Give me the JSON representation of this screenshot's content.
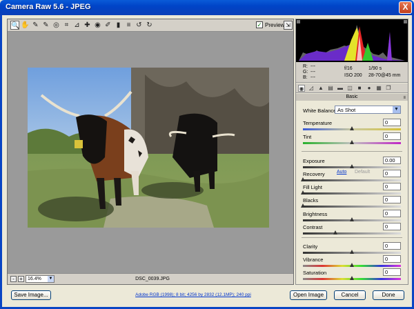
{
  "window": {
    "title": "Camera Raw 5.6  -  JPEG",
    "close_glyph": "X"
  },
  "toolbar": {
    "tools": [
      {
        "name": "zoom-tool-icon",
        "glyph": "🔍"
      },
      {
        "name": "hand-tool-icon",
        "glyph": "✋"
      },
      {
        "name": "white-balance-tool-icon",
        "glyph": "✎"
      },
      {
        "name": "color-sampler-tool-icon",
        "glyph": "✎"
      },
      {
        "name": "targeted-adjustment-tool-icon",
        "glyph": "◎"
      },
      {
        "name": "crop-tool-icon",
        "glyph": "⌗"
      },
      {
        "name": "straighten-tool-icon",
        "glyph": "⊿"
      },
      {
        "name": "spot-removal-tool-icon",
        "glyph": "✚"
      },
      {
        "name": "red-eye-tool-icon",
        "glyph": "◉"
      },
      {
        "name": "adjustment-brush-icon",
        "glyph": "✐"
      },
      {
        "name": "graduated-filter-icon",
        "glyph": "▮"
      },
      {
        "name": "preferences-icon",
        "glyph": "≡"
      },
      {
        "name": "rotate-ccw-icon",
        "glyph": "↺"
      },
      {
        "name": "rotate-cw-icon",
        "glyph": "↻"
      }
    ],
    "preview_label": "Preview",
    "preview_checked": true
  },
  "statusbar": {
    "zoom_value": "16.4%",
    "filename": "DSC_0039.JPG",
    "zoom_out": "-",
    "zoom_in": "+"
  },
  "readout": {
    "r_label": "R:",
    "g_label": "G:",
    "b_label": "B:",
    "r_value": "---",
    "g_value": "---",
    "b_value": "---",
    "aperture": "f/16",
    "shutter": "1/90 s",
    "iso": "ISO 200",
    "focal": "28-70@45 mm"
  },
  "panel": {
    "title": "Basic",
    "white_balance_label": "White Balance:",
    "white_balance_value": "As Shot",
    "auto_label": "Auto",
    "default_label": "Default",
    "controls": [
      {
        "label": "Temperature",
        "value": "0",
        "pos": 0.5
      },
      {
        "label": "Tint",
        "value": "0",
        "pos": 0.5
      },
      {
        "label": "Exposure",
        "value": "0.00",
        "pos": 0.5
      },
      {
        "label": "Recovery",
        "value": "0",
        "pos": 0.0
      },
      {
        "label": "Fill Light",
        "value": "0",
        "pos": 0.0
      },
      {
        "label": "Blacks",
        "value": "0",
        "pos": 0.0
      },
      {
        "label": "Brightness",
        "value": "0",
        "pos": 0.5
      },
      {
        "label": "Contrast",
        "value": "0",
        "pos": 0.33
      },
      {
        "label": "Clarity",
        "value": "0",
        "pos": 0.5
      },
      {
        "label": "Vibrance",
        "value": "0",
        "pos": 0.5
      },
      {
        "label": "Saturation",
        "value": "0",
        "pos": 0.5
      }
    ]
  },
  "bottom": {
    "save_label": "Save Image...",
    "workflow_link": "Adobe RGB (1998); 8 bit; 4256 by 2832 (12.1MP); 240 ppi",
    "open_label": "Open Image",
    "cancel_label": "Cancel",
    "done_label": "Done"
  }
}
